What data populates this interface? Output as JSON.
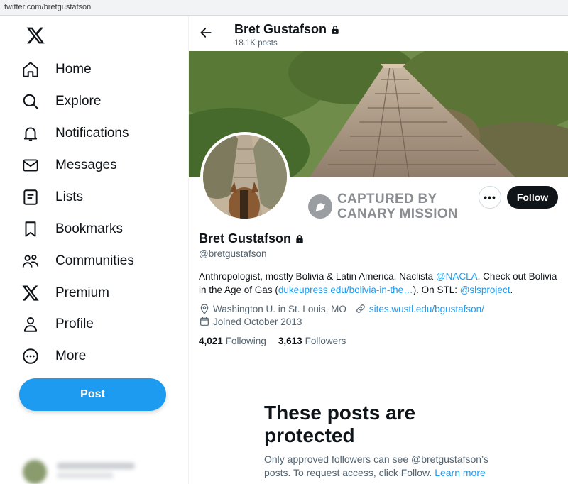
{
  "browser": {
    "url": "twitter.com/bretgustafson"
  },
  "sidebar": {
    "logo_icon": "x-logo-icon",
    "items": [
      {
        "label": "Home",
        "icon": "home-icon"
      },
      {
        "label": "Explore",
        "icon": "search-icon"
      },
      {
        "label": "Notifications",
        "icon": "bell-icon"
      },
      {
        "label": "Messages",
        "icon": "envelope-icon"
      },
      {
        "label": "Lists",
        "icon": "list-icon"
      },
      {
        "label": "Bookmarks",
        "icon": "bookmark-icon"
      },
      {
        "label": "Communities",
        "icon": "people-icon"
      },
      {
        "label": "Premium",
        "icon": "x-logo-icon"
      },
      {
        "label": "Profile",
        "icon": "person-icon"
      },
      {
        "label": "More",
        "icon": "more-circle-icon"
      }
    ],
    "post_label": "Post"
  },
  "header": {
    "name": "Bret Gustafson",
    "posts_count": "18.1K posts"
  },
  "watermark": {
    "line1": "CAPTURED BY",
    "line2": "CANARY MISSION"
  },
  "actions": {
    "more_label": "•••",
    "follow_label": "Follow"
  },
  "profile": {
    "name": "Bret Gustafson",
    "handle": "@bretgustafson",
    "bio": {
      "part1": "Anthropologist, mostly Bolivia & Latin America. Naclista ",
      "mention1": "@NACLA",
      "part2": ". Check out Bolivia in the Age of Gas (",
      "link1": "dukeupress.edu/bolivia-in-the…",
      "part3": ").   On STL: ",
      "mention2": "@slsproject",
      "part4": "."
    },
    "location": "Washington U. in St. Louis, MO",
    "website": "sites.wustl.edu/bgustafson/",
    "joined": "Joined October 2013",
    "following_count": "4,021",
    "following_label": "Following",
    "followers_count": "3,613",
    "followers_label": "Followers"
  },
  "protected": {
    "title": "These posts are protected",
    "text": "Only approved followers can see @bretgustafson’s posts. To request access, click Follow. ",
    "learn_more": "Learn more"
  },
  "colors": {
    "accent": "#1d9bf0",
    "text": "#0f1419",
    "secondary_text": "#536471",
    "follow_button": "#0f1419"
  }
}
